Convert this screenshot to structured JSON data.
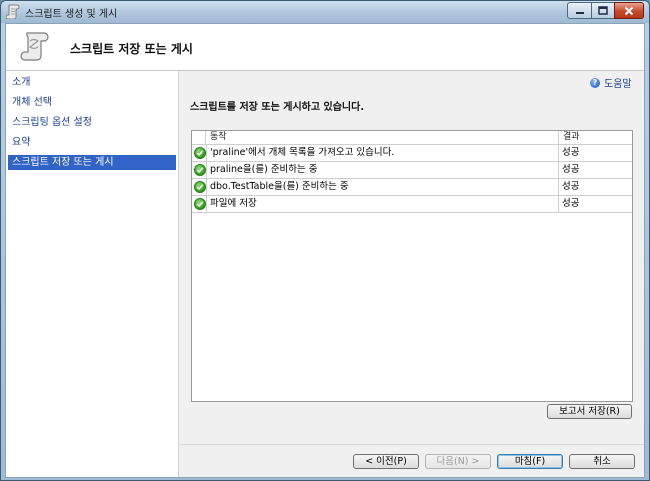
{
  "window": {
    "title": "스크립트 생성 및 게시"
  },
  "header": {
    "title": "스크립트 저장 또는 게시"
  },
  "sidebar": {
    "items": [
      {
        "label": "소개"
      },
      {
        "label": "개체 선택"
      },
      {
        "label": "스크립팅 옵션 설정"
      },
      {
        "label": "요약"
      },
      {
        "label": "스크립트 저장 또는 게시"
      }
    ],
    "active_index": 4
  },
  "help": {
    "label": "도움말"
  },
  "main": {
    "status_heading": "스크립트를 저장 또는 게시하고 있습니다.",
    "table": {
      "columns": [
        "동작",
        "결과"
      ],
      "rows": [
        {
          "action": "'praline'에서 개체 목록을 가져오고 있습니다.",
          "result": "성공"
        },
        {
          "action": "praline을(를) 준비하는 중",
          "result": "성공"
        },
        {
          "action": "dbo.TestTable을(를) 준비하는 중",
          "result": "성공"
        },
        {
          "action": "파일에 저장",
          "result": "성공"
        }
      ]
    },
    "save_report_label": "보고서 저장(R)"
  },
  "footer": {
    "prev_label": "< 이전(P)",
    "next_label": "다음(N) >",
    "finish_label": "마침(F)",
    "cancel_label": "취소"
  },
  "colors": {
    "nav_active": "#3264c8",
    "link": "#1c3f90",
    "success_icon": "#2f9a1c"
  },
  "icons": {
    "app": "script-scroll-icon",
    "header": "script-scroll-icon",
    "help": "help-icon",
    "status": "success-check-icon"
  }
}
